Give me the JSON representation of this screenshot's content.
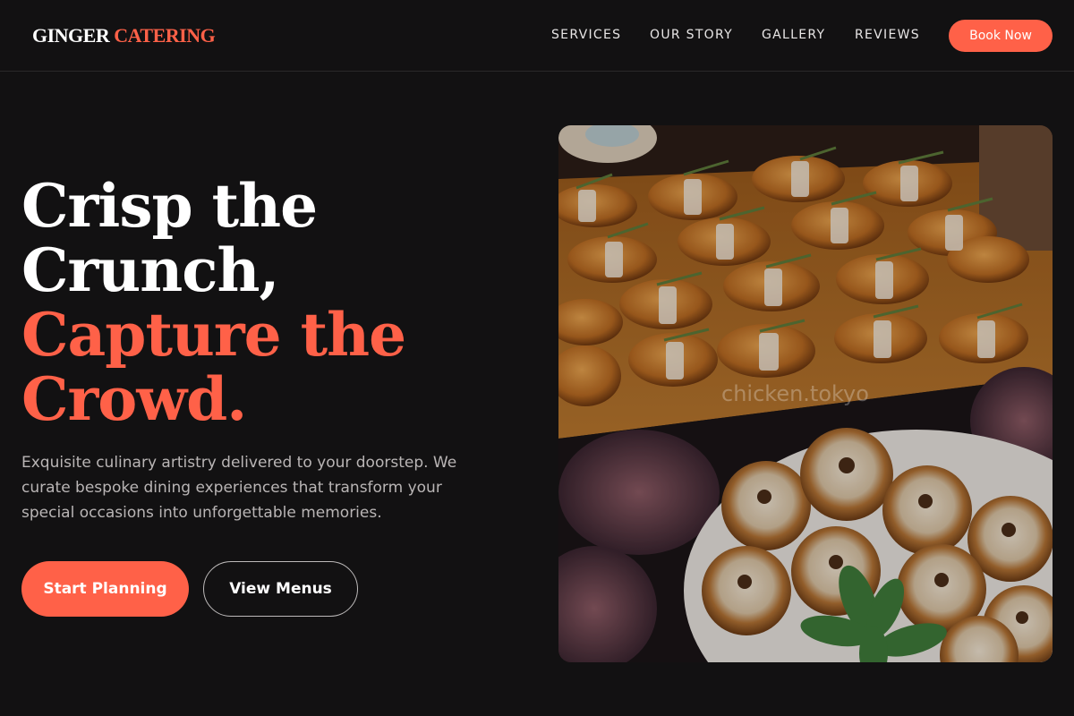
{
  "header": {
    "logo_part1": "GINGER",
    "logo_part2": "CATERING",
    "nav": [
      "SERVICES",
      "OUR STORY",
      "GALLERY",
      "REVIEWS"
    ],
    "cta_label": "Book Now"
  },
  "hero": {
    "headline_line1": "Crisp the",
    "headline_line2": "Crunch,",
    "headline_line3": "Capture the",
    "headline_line4": "Crowd.",
    "description": "Exquisite culinary artistry delivered to your doorstep. We curate bespoke dining experiences that transform your special occasions into unforgettable memories.",
    "primary_button": "Start Planning",
    "secondary_button": "View Menus",
    "image_watermark": "chicken.tokyo"
  },
  "colors": {
    "background": "#121112",
    "accent": "#ff6148",
    "text": "#ffffff",
    "muted_text": "#b9b5b5"
  }
}
